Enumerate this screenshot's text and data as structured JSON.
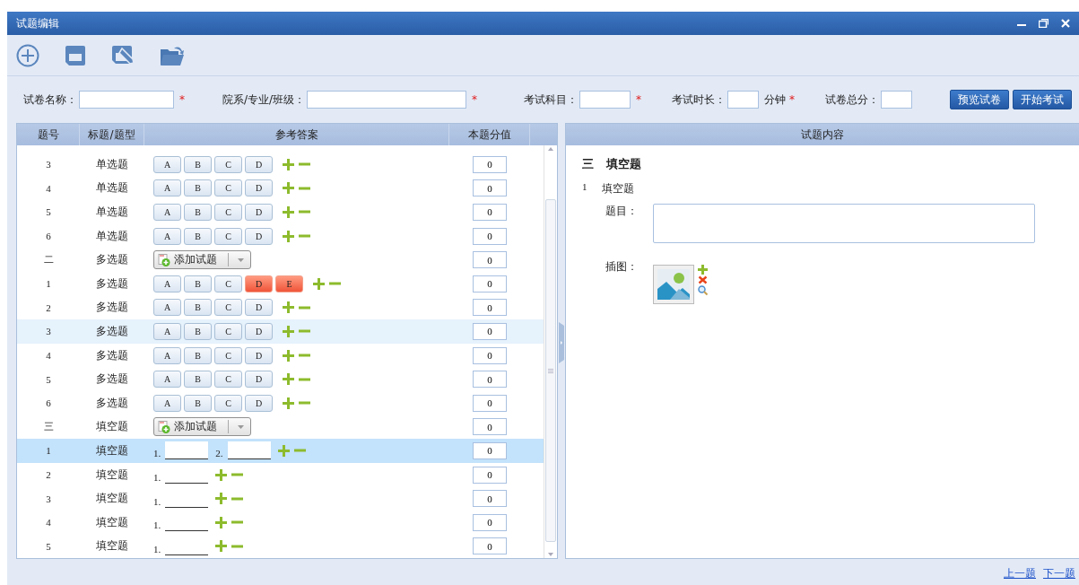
{
  "window": {
    "title": "试题编辑"
  },
  "form": {
    "fields": [
      {
        "label": "试卷名称：",
        "required_mark": "*"
      },
      {
        "label": "院系/专业/班级：",
        "required_mark": "*"
      },
      {
        "label": "考试科目：",
        "required_mark": "*"
      },
      {
        "label": "考试时长：",
        "unit": "分钟",
        "required_mark": "*"
      },
      {
        "label": "试卷总分："
      }
    ],
    "buttons": [
      "预览试卷",
      "开始考试"
    ]
  },
  "question_table": {
    "columns": [
      "题号",
      "标题/题型",
      "参考答案",
      "本题分值"
    ],
    "rows": [
      {
        "number": "3",
        "type": "单选题",
        "answer": {
          "kind": "choice",
          "options": [
            {
              "label": "A",
              "selected": false
            },
            {
              "label": "B",
              "selected": false
            },
            {
              "label": "C",
              "selected": false
            },
            {
              "label": "D",
              "selected": false
            }
          ]
        },
        "score": "0",
        "selected": false,
        "hovered": false
      },
      {
        "number": "4",
        "type": "单选题",
        "answer": {
          "kind": "choice",
          "options": [
            {
              "label": "A",
              "selected": false
            },
            {
              "label": "B",
              "selected": false
            },
            {
              "label": "C",
              "selected": false
            },
            {
              "label": "D",
              "selected": false
            }
          ]
        },
        "score": "0",
        "selected": false,
        "hovered": false
      },
      {
        "number": "5",
        "type": "单选题",
        "answer": {
          "kind": "choice",
          "options": [
            {
              "label": "A",
              "selected": false
            },
            {
              "label": "B",
              "selected": false
            },
            {
              "label": "C",
              "selected": false
            },
            {
              "label": "D",
              "selected": false
            }
          ]
        },
        "score": "0",
        "selected": false,
        "hovered": false
      },
      {
        "number": "6",
        "type": "单选题",
        "answer": {
          "kind": "choice",
          "options": [
            {
              "label": "A",
              "selected": false
            },
            {
              "label": "B",
              "selected": false
            },
            {
              "label": "C",
              "selected": false
            },
            {
              "label": "D",
              "selected": false
            }
          ]
        },
        "score": "0",
        "selected": false,
        "hovered": false
      },
      {
        "number": "二",
        "type": "多选题",
        "answer": {
          "kind": "add",
          "label": "添加试题"
        },
        "score": "0",
        "selected": false,
        "hovered": false
      },
      {
        "number": "1",
        "type": "多选题",
        "answer": {
          "kind": "choice",
          "options": [
            {
              "label": "A",
              "selected": false
            },
            {
              "label": "B",
              "selected": false
            },
            {
              "label": "C",
              "selected": false
            },
            {
              "label": "D",
              "selected": true
            },
            {
              "label": "E",
              "selected": true
            }
          ]
        },
        "score": "0",
        "selected": false,
        "hovered": false
      },
      {
        "number": "2",
        "type": "多选题",
        "answer": {
          "kind": "choice",
          "options": [
            {
              "label": "A",
              "selected": false
            },
            {
              "label": "B",
              "selected": false
            },
            {
              "label": "C",
              "selected": false
            },
            {
              "label": "D",
              "selected": false
            }
          ]
        },
        "score": "0",
        "selected": false,
        "hovered": false
      },
      {
        "number": "3",
        "type": "多选题",
        "answer": {
          "kind": "choice",
          "options": [
            {
              "label": "A",
              "selected": false
            },
            {
              "label": "B",
              "selected": false
            },
            {
              "label": "C",
              "selected": false
            },
            {
              "label": "D",
              "selected": false
            }
          ]
        },
        "score": "0",
        "selected": false,
        "hovered": true
      },
      {
        "number": "4",
        "type": "多选题",
        "answer": {
          "kind": "choice",
          "options": [
            {
              "label": "A",
              "selected": false
            },
            {
              "label": "B",
              "selected": false
            },
            {
              "label": "C",
              "selected": false
            },
            {
              "label": "D",
              "selected": false
            }
          ]
        },
        "score": "0",
        "selected": false,
        "hovered": false
      },
      {
        "number": "5",
        "type": "多选题",
        "answer": {
          "kind": "choice",
          "options": [
            {
              "label": "A",
              "selected": false
            },
            {
              "label": "B",
              "selected": false
            },
            {
              "label": "C",
              "selected": false
            },
            {
              "label": "D",
              "selected": false
            }
          ]
        },
        "score": "0",
        "selected": false,
        "hovered": false
      },
      {
        "number": "6",
        "type": "多选题",
        "answer": {
          "kind": "choice",
          "options": [
            {
              "label": "A",
              "selected": false
            },
            {
              "label": "B",
              "selected": false
            },
            {
              "label": "C",
              "selected": false
            },
            {
              "label": "D",
              "selected": false
            }
          ]
        },
        "score": "0",
        "selected": false,
        "hovered": false
      },
      {
        "number": "三",
        "type": "填空题",
        "answer": {
          "kind": "add",
          "label": "添加试题"
        },
        "score": "0",
        "selected": false,
        "hovered": false
      },
      {
        "number": "1",
        "type": "填空题",
        "answer": {
          "kind": "blank",
          "blanks": [
            {
              "label": "1."
            },
            {
              "label": "2."
            }
          ]
        },
        "score": "0",
        "selected": true,
        "hovered": false
      },
      {
        "number": "2",
        "type": "填空题",
        "answer": {
          "kind": "blank",
          "blanks": [
            {
              "label": "1."
            }
          ]
        },
        "score": "0",
        "selected": false,
        "hovered": false
      },
      {
        "number": "3",
        "type": "填空题",
        "answer": {
          "kind": "blank",
          "blanks": [
            {
              "label": "1."
            }
          ]
        },
        "score": "0",
        "selected": false,
        "hovered": false
      },
      {
        "number": "4",
        "type": "填空题",
        "answer": {
          "kind": "blank",
          "blanks": [
            {
              "label": "1."
            }
          ]
        },
        "score": "0",
        "selected": false,
        "hovered": false
      },
      {
        "number": "5",
        "type": "填空题",
        "answer": {
          "kind": "blank",
          "blanks": [
            {
              "label": "1."
            }
          ]
        },
        "score": "0",
        "selected": false,
        "hovered": false
      }
    ]
  },
  "detail": {
    "title": "试题内容",
    "section_number": "三",
    "section_title": "填空题",
    "question_number": "1",
    "question_type": "填空题",
    "stem_label": "题目：",
    "image_label": "插图："
  },
  "footer": {
    "links": [
      "上一题",
      "下一题"
    ]
  }
}
